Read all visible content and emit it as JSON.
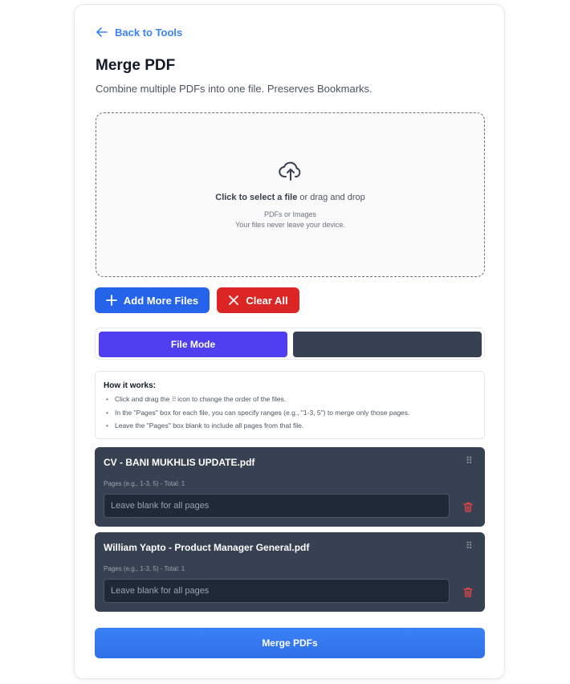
{
  "nav": {
    "back_label": "Back to Tools"
  },
  "header": {
    "title": "Merge PDF",
    "description": "Combine multiple PDFs into one file. Preserves Bookmarks."
  },
  "dropzone": {
    "cta_bold": "Click to select a file",
    "cta_rest": " or drag and drop",
    "accepted": "PDFs or Images",
    "privacy": "Your files never leave your device."
  },
  "actions": {
    "add_label": "Add More Files",
    "clear_label": "Clear All"
  },
  "modes": {
    "active_label": "File Mode",
    "other_label": ""
  },
  "howto": {
    "title": "How it works:",
    "step1_before": "Click and drag the ",
    "step1_after": " icon to change the order of the files.",
    "step2": "In the \"Pages\" box for each file, you can specify ranges (e.g., \"1-3, 5\") to merge only those pages.",
    "step3": "Leave the \"Pages\" box blank to include all pages from that file."
  },
  "files": [
    {
      "name": "CV - BANI MUKHLIS UPDATE.pdf",
      "pages_label": "Pages (e.g., 1-3, 5) - Total: 1",
      "placeholder": "Leave blank for all pages"
    },
    {
      "name": "William Yapto - Product Manager General.pdf",
      "pages_label": "Pages (e.g., 1-3, 5) - Total: 1",
      "placeholder": "Leave blank for all pages"
    }
  ],
  "merge_label": "Merge PDFs",
  "icons": {
    "back": "arrow-left-icon",
    "upload": "cloud-upload-icon",
    "add": "plus-icon",
    "clear": "close-icon",
    "drag": "grip-icon",
    "delete": "trash-icon"
  },
  "colors": {
    "primary": "#2563eb",
    "danger": "#dc2626",
    "mode_active": "#4f3ff0",
    "file_card": "#374151"
  }
}
